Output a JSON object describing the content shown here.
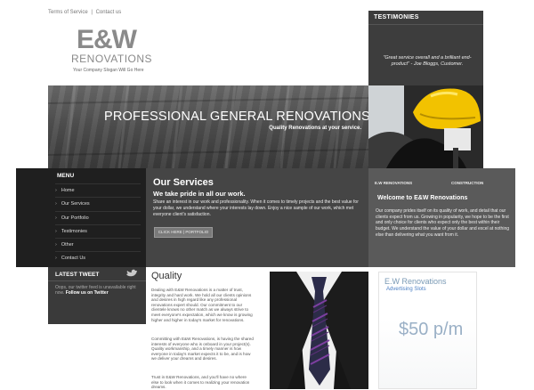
{
  "top_links": {
    "terms": "Terms of Service",
    "separator": "|",
    "contact": "Contact us"
  },
  "logo": {
    "mark": "E&W",
    "name": "RENOVATIONS",
    "slogan": "Your Company Slogan Will Go Here"
  },
  "testimonies": {
    "heading": "TESTIMONIES",
    "quote": "\"Great service overall and a brilliant end-product\" - Joe Bloggs, Customer."
  },
  "banner": {
    "title": "PROFESSIONAL GENERAL RENOVATIONS",
    "subtitle": "Quality Renovations at your service."
  },
  "menu": {
    "heading": "MENU",
    "bullet": "›",
    "items": [
      {
        "label": "Home"
      },
      {
        "label": "Our Services"
      },
      {
        "label": "Our Portfolio"
      },
      {
        "label": "Testimonies"
      },
      {
        "label": "Other"
      },
      {
        "label": "Contact Us"
      }
    ]
  },
  "services": {
    "heading": "Our Services",
    "subheading": "We take pride in all our work.",
    "text": "Share an interest in our work and professionality. When it comes to timely projects and the best value for your dollar, we understand where your interests lay down. Enjoy a nice sample of our work, which met everyone client's satisfaction.",
    "button_label": "CLICK HERE | PORTFOLIO"
  },
  "welcome": {
    "tab1": "E.W RENOVATIONS",
    "tab2": "CONSTRUCTION",
    "heading": "Welcome to E&W Renovations",
    "text": "Our company prides itself on its quality of work, and detail that our clients expect from us. Growing in popularity, we hope to be the first and only choice for clients who expect only the best within their budget. We understand the value of your dollar and excel at nothing else than delivering what you want from it."
  },
  "tweet": {
    "heading": "LATEST TWEET",
    "text": "Oops, our twitter feed is unavailable right now.",
    "follow": "Follow us on Twitter"
  },
  "quality": {
    "heading": "Quality",
    "paragraphs": [
      "Dealing with E&W Renovations is a matter of trust, integrity and hard work. We hold all our clients opinions and desires in high regard like any professional renovations expert should. Our commitment to our clientele knows no other match as we always strive to meet everyone's expectation, which we know is growing higher and higher in today's market for renovations.",
      "Committing with E&W Renovations, is having the shared interests of everyone who is onboard in your project(s). Quality workmanship, and a timely manner is how everyone in today's market expects it to be, and is how we deliver your dreams and desires.",
      "Trust in E&W Renovations, and you'll have no where else to look when it comes to realizing your renovation dreams."
    ]
  },
  "ad": {
    "heading": "E.W Renovations",
    "subheading": "Advertising Slots",
    "price": "$50 p/m"
  }
}
